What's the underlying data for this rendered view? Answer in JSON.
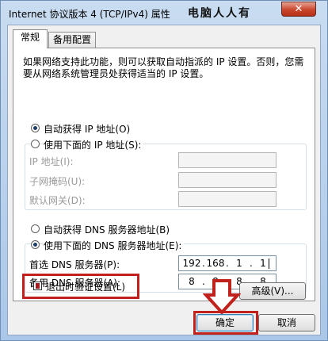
{
  "window": {
    "title": "Internet 协议版本 4 (TCP/IPv4) 属性",
    "watermark": "电脑人人有",
    "close_label": "✕"
  },
  "tabs": [
    {
      "label": "常规",
      "active": true
    },
    {
      "label": "备用配置",
      "active": false
    }
  ],
  "description": "如果网络支持此功能，则可以获取自动指派的 IP 设置。否则，您需要从网络系统管理员处获得适当的 IP 设置。",
  "ip_section": {
    "auto_label": "自动获得 IP 地址(O)",
    "manual_label": "使用下面的 IP 地址(S):",
    "selected": "auto",
    "fields": [
      {
        "label": "IP 地址(I):"
      },
      {
        "label": "子网掩码(U):"
      },
      {
        "label": "默认网关(D):"
      }
    ]
  },
  "dns_section": {
    "auto_label": "自动获得 DNS 服务器地址(B)",
    "manual_label": "使用下面的 DNS 服务器地址(E):",
    "selected": "manual",
    "preferred": {
      "label": "首选 DNS 服务器(P):",
      "octets": [
        "192",
        "168",
        "1",
        "1"
      ]
    },
    "alternate": {
      "label": "备用 DNS 服务器(A):",
      "octets": [
        "8",
        "8",
        "8",
        "8"
      ]
    }
  },
  "validate_on_exit": {
    "label": "退出时验证设置(L)",
    "checked": true
  },
  "buttons": {
    "advanced": "高级(V)...",
    "ok": "确定",
    "cancel": "取消"
  },
  "colors": {
    "highlight": "#c0211c"
  }
}
